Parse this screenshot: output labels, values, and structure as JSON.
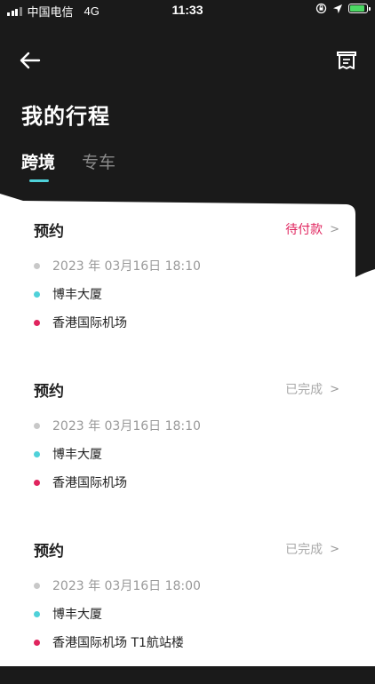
{
  "status_bar": {
    "carrier": "中国电信",
    "network": "4G",
    "time": "11:33"
  },
  "header": {
    "title": "我的行程",
    "back_icon": "arrow-left-icon",
    "receipt_icon": "receipt-icon"
  },
  "tabs": [
    {
      "label": "跨境",
      "active": true
    },
    {
      "label": "专车",
      "active": false
    }
  ],
  "colors": {
    "accent": "#4fd1d9",
    "pending": "#e0245e",
    "background_dark": "#1a1a1a"
  },
  "trips": [
    {
      "type": "预约",
      "status": "待付款",
      "status_kind": "pending",
      "time": "2023 年 03月16日 18:10",
      "from": "博丰大厦",
      "to": "香港国际机场"
    },
    {
      "type": "预约",
      "status": "已完成",
      "status_kind": "done",
      "time": "2023 年 03月16日 18:10",
      "from": "博丰大厦",
      "to": "香港国际机场"
    },
    {
      "type": "预约",
      "status": "已完成",
      "status_kind": "done",
      "time": "2023 年 03月16日 18:00",
      "from": "博丰大厦",
      "to": "香港国际机场 T1航站楼"
    }
  ],
  "chevron": ">"
}
